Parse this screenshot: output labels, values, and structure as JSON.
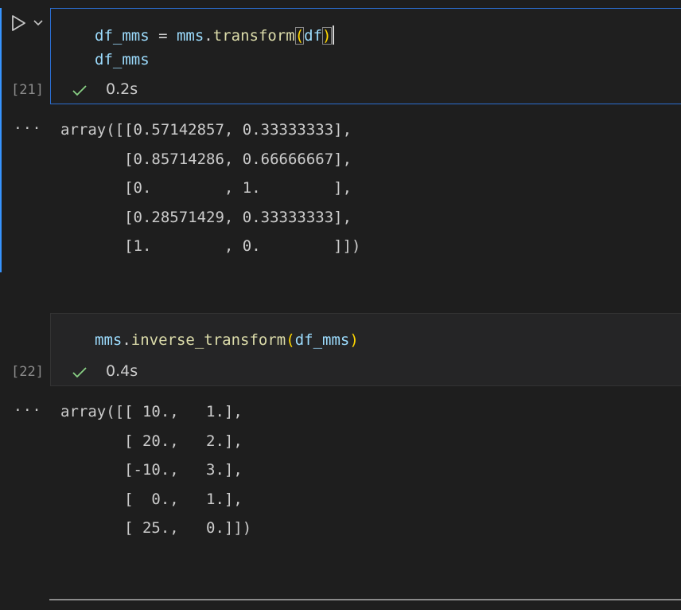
{
  "cells": [
    {
      "execution_count": "[21]",
      "code": {
        "line1": {
          "var": "df_mms",
          "eq": " = ",
          "obj": "mms",
          "dot": ".",
          "method": "transform",
          "open": "(",
          "arg": "df",
          "close": ")"
        },
        "line2": "df_mms"
      },
      "status_icon": "check-icon",
      "exec_time": "0.2s",
      "output": "array([[0.57142857, 0.33333333],\n       [0.85714286, 0.66666667],\n       [0.        , 1.        ],\n       [0.28571429, 0.33333333],\n       [1.        , 0.        ]])"
    },
    {
      "execution_count": "[22]",
      "code": {
        "line1": {
          "obj": "mms",
          "dot": ".",
          "method": "inverse_transform",
          "open": "(",
          "arg": "df_mms",
          "close": ")"
        }
      },
      "status_icon": "check-icon",
      "exec_time": "0.4s",
      "output": "array([[ 10.,   1.],\n       [ 20.,   2.],\n       [-10.,   3.],\n       [  0.,   1.],\n       [ 25.,   0.]])"
    }
  ],
  "toolbar": {
    "run_icon": "play-icon",
    "more_icon": "chevron-down-icon",
    "output_menu_label": "···"
  },
  "colors": {
    "background": "#1e1e1e",
    "focus_border": "#2b6ed1",
    "focus_bar": "#3794ff",
    "success": "#89d185",
    "variable": "#9cdcfe",
    "function": "#dcdcaa",
    "paren": "#ffd700"
  }
}
